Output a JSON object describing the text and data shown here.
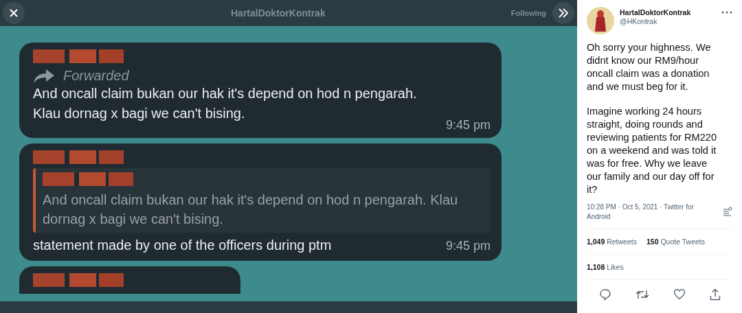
{
  "viewer": {
    "header": {
      "title": "HartalDoktorKontrak",
      "follow_button": "Following"
    },
    "messages": [
      {
        "kind": "forwarded",
        "label": "Forwarded",
        "text": "And oncall claim bukan our hak it's depend on hod n pengarah.\nKlau dornag x bagi we can't bising.",
        "time": "9:45 pm"
      },
      {
        "kind": "reply",
        "quote": "And oncall claim bukan our hak it's depend on hod n pengarah. Klau dornag x bagi we can't bising.",
        "text": "statement made by one of the officers during ptm",
        "time": "9:45 pm"
      },
      {
        "kind": "partial"
      }
    ]
  },
  "tweet": {
    "name": "HartalDoktorKontrak",
    "handle": "@HKontrak",
    "paragraphs": [
      "Oh sorry your highness. We didnt know our RM9/hour oncall claim was a donation and we must beg for it.",
      "Imagine working 24 hours straight, doing rounds and reviewing patients for RM220 on a weekend and was told it was for free. Why we leave our family and our day off for it?"
    ],
    "meta": "10:28 PM · Oct 5, 2021 · Twitter for Android",
    "stats": [
      {
        "count": "1,049",
        "label": "Retweets"
      },
      {
        "count": "150",
        "label": "Quote Tweets"
      }
    ],
    "likes": {
      "count": "1,108",
      "label": "Likes"
    }
  }
}
